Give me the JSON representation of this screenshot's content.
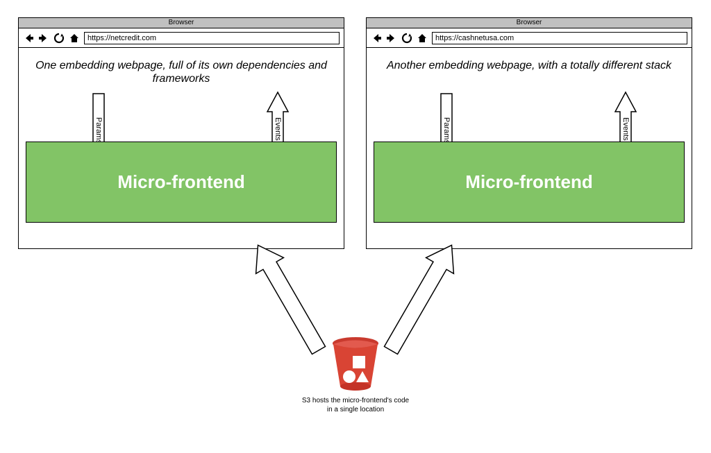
{
  "browserWindows": [
    {
      "titlebar": "Browser",
      "url": "https://netcredit.com",
      "description": "One embedding webpage, full of its own dependencies and frameworks",
      "mfLabel": "Micro-frontend",
      "paramsLabel": "Params",
      "eventsLabel": "Events"
    },
    {
      "titlebar": "Browser",
      "url": "https://cashnetusa.com",
      "description": "Another embedding webpage, with a totally different stack",
      "mfLabel": "Micro-frontend",
      "paramsLabel": "Params",
      "eventsLabel": "Events"
    }
  ],
  "bucketCaption": "S3 hosts the micro-frontend's code in a single location"
}
